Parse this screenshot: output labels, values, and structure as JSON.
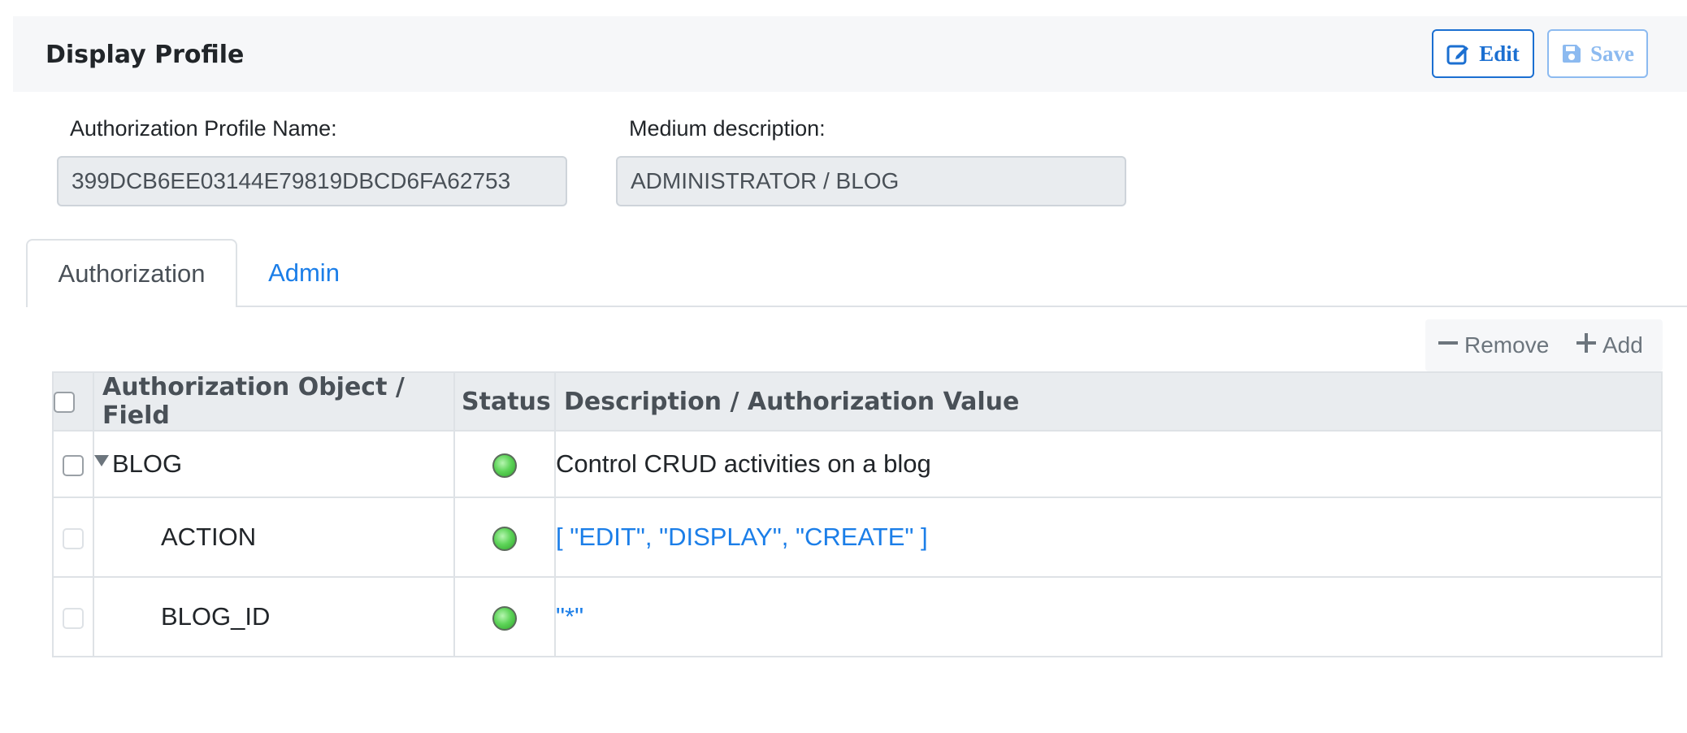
{
  "header": {
    "title": "Display Profile",
    "edit_label": "Edit",
    "save_label": "Save"
  },
  "fields": {
    "profile_name_label": "Authorization Profile Name:",
    "profile_name_value": "399DCB6EE03144E79819DBCD6FA62753",
    "medium_desc_label": "Medium description:",
    "medium_desc_value": "ADMINISTRATOR / BLOG"
  },
  "tabs": [
    {
      "label": "Authorization",
      "active": true
    },
    {
      "label": "Admin",
      "active": false
    }
  ],
  "toolbar": {
    "remove_label": "Remove",
    "add_label": "Add"
  },
  "table": {
    "columns": [
      "Authorization Object / Field",
      "Status",
      "Description / Authorization Value"
    ],
    "rows": [
      {
        "name": "BLOG",
        "status": "green",
        "text": "Control CRUD activities on a blog"
      },
      {
        "name": "ACTION",
        "status": "green",
        "text": "[ \"EDIT\", \"DISPLAY\", \"CREATE\" ]"
      },
      {
        "name": "BLOG_ID",
        "status": "green",
        "text": "\"*\""
      }
    ]
  },
  "colors": {
    "accent": "#1b6fd1",
    "link": "#1b7ee8",
    "status_green": "#5fd55a",
    "header_bg": "#f6f7f9"
  },
  "icons": {
    "edit": "pencil-square-icon",
    "save": "floppy-disk-icon",
    "remove": "minus-icon",
    "add": "plus-icon",
    "expand": "caret-down-icon",
    "status": "status-light-icon"
  }
}
